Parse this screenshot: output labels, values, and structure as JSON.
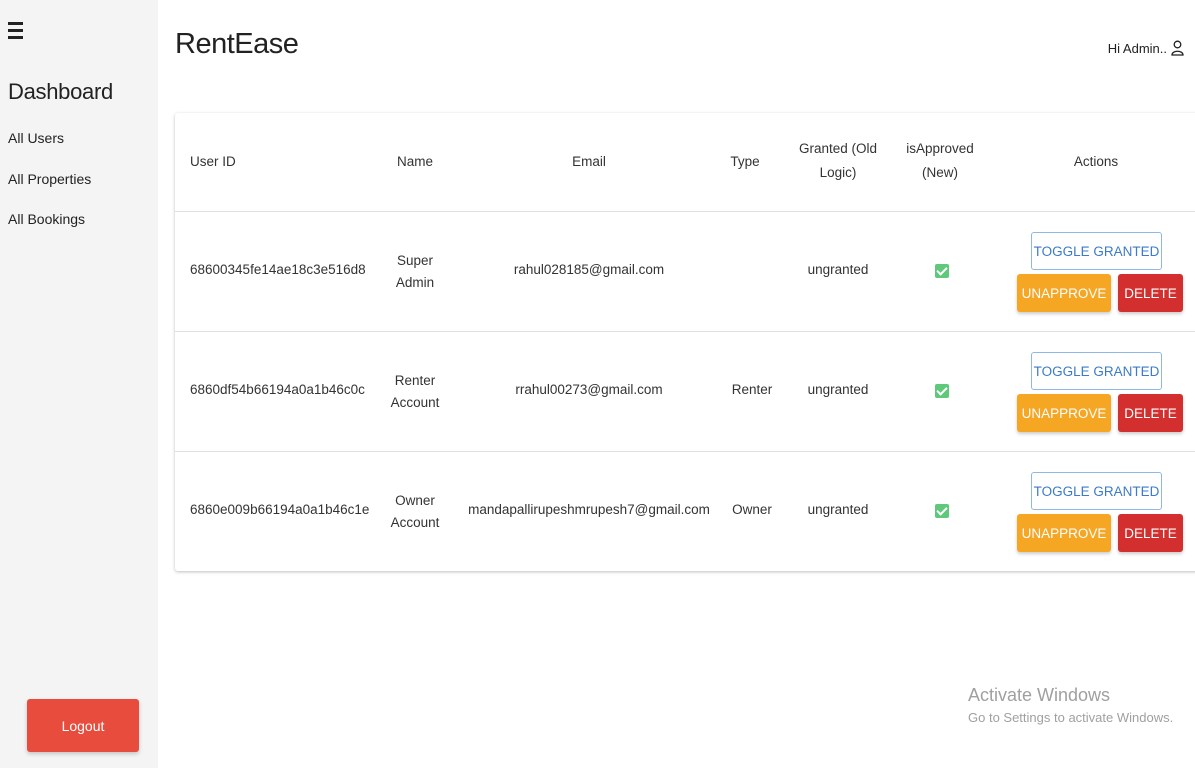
{
  "sidebar": {
    "title": "Dashboard",
    "items": [
      {
        "label": "All Users"
      },
      {
        "label": "All Properties"
      },
      {
        "label": "All Bookings"
      }
    ],
    "logout_label": "Logout"
  },
  "header": {
    "brand": "RentEase",
    "greeting": "Hi Admin..",
    "icon": "user-icon"
  },
  "table": {
    "headers": {
      "user_id": "User ID",
      "name": "Name",
      "email": "Email",
      "type": "Type",
      "granted_line1": "Granted (Old",
      "granted_line2": "Logic)",
      "approved_line1": "isApproved",
      "approved_line2": "(New)",
      "actions": "Actions"
    },
    "rows": [
      {
        "user_id": "68600345fe14ae18c3e516d8",
        "name_line1": "Super",
        "name_line2": "Admin",
        "email": "rahul028185@gmail.com",
        "type": "",
        "granted": "ungranted",
        "approved": true
      },
      {
        "user_id": "6860df54b66194a0a1b46c0c",
        "name_line1": "Renter",
        "name_line2": "Account",
        "email": "rrahul00273@gmail.com",
        "type": "Renter",
        "granted": "ungranted",
        "approved": true
      },
      {
        "user_id": "6860e009b66194a0a1b46c1e",
        "name_line1": "Owner",
        "name_line2": "Account",
        "email": "mandapallirupeshmrupesh7@gmail.com",
        "type": "Owner",
        "granted": "ungranted",
        "approved": true
      }
    ],
    "actions": {
      "toggle": "TOGGLE GRANTED",
      "unapprove": "UNAPPROVE",
      "delete": "DELETE"
    }
  },
  "watermark": {
    "title": "Activate Windows",
    "subtitle": "Go to Settings to activate Windows."
  },
  "colors": {
    "logout": "#e74c3c",
    "unapprove": "#f5a623",
    "delete": "#d32f2f",
    "toggle": "#3b7bc8",
    "check": "#5fc87a"
  }
}
